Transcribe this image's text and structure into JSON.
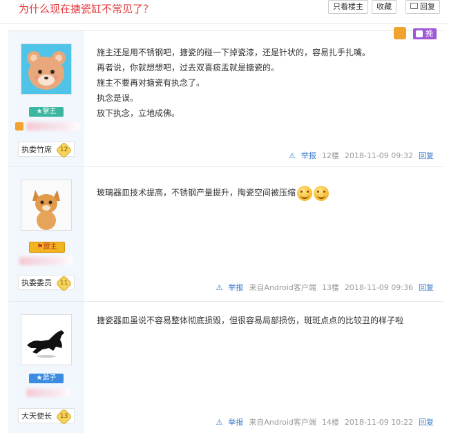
{
  "header": {
    "title": "为什么现在搪瓷缸不常见了？",
    "buttons": [
      "只看楼主",
      "收藏",
      "回复"
    ]
  },
  "posts": [
    {
      "badge": "掌主",
      "user_title": "执委竹席",
      "level": "12",
      "vip_label": "挽尊",
      "content": [
        "施主还是用不锈钢吧，搪瓷的碰一下掉瓷漆，还是针状的，容易扎手扎嘴。",
        "再者说，你就想想吧，过去双喜痰盂就是搪瓷的。",
        "施主不要再对搪瓷有执念了。",
        "执念是误。",
        "放下执念，立地成佛。"
      ],
      "report": "举报",
      "source": "",
      "floor": "12楼",
      "time": "2018-11-09 09:32",
      "reply": "回复"
    },
    {
      "badge": "盟主",
      "user_title": "执委委员",
      "level": "11",
      "content": [
        "玻璃器皿技术提高，不锈钢产量提升，陶瓷空间被压缩"
      ],
      "report": "举报",
      "source": "来自Android客户端",
      "floor": "13楼",
      "time": "2018-11-09 09:36",
      "reply": "回复"
    },
    {
      "badge": "弟子",
      "user_title": "大天使长",
      "level": "13",
      "content": [
        "搪瓷器皿虽说不容易整体彻底损毁，但很容易局部损伤，斑斑点点的比较丑的样子啦"
      ],
      "report": "举报",
      "source": "来自Android客户端",
      "floor": "14楼",
      "time": "2018-11-09 10:22",
      "reply": "回复"
    }
  ]
}
